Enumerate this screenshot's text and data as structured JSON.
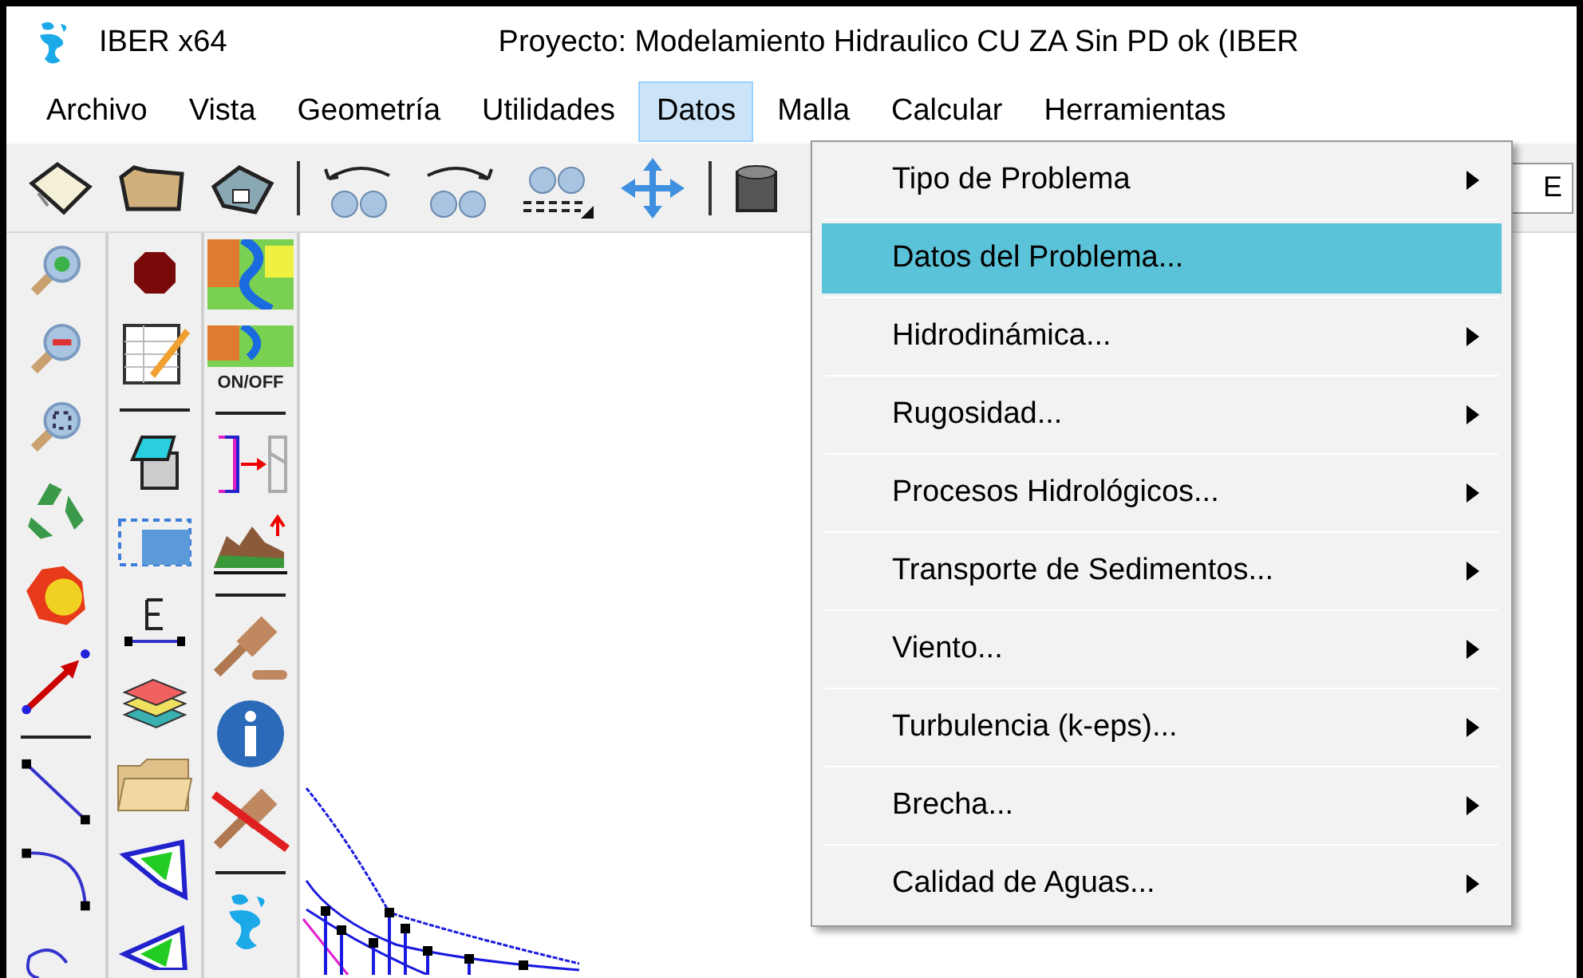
{
  "window": {
    "app_name": "IBER x64",
    "title": "Proyecto: Modelamiento Hidraulico CU ZA Sin PD ok (IBER"
  },
  "menu_bar": [
    {
      "label": "Archivo",
      "selected": false
    },
    {
      "label": "Vista",
      "selected": false
    },
    {
      "label": "Geometría",
      "selected": false
    },
    {
      "label": "Utilidades",
      "selected": false
    },
    {
      "label": "Datos",
      "selected": true
    },
    {
      "label": "Malla",
      "selected": false
    },
    {
      "label": "Calcular",
      "selected": false
    },
    {
      "label": "Herramientas",
      "selected": false
    }
  ],
  "toolbar_field": {
    "value": "E"
  },
  "layer_icon_label": "ON/OFF",
  "dropdown": [
    {
      "label": "Tipo de Problema",
      "submenu": true,
      "selected": false
    },
    {
      "label": "Datos del Problema...",
      "submenu": false,
      "selected": true
    },
    {
      "label": "Hidrodinámica...",
      "submenu": true,
      "selected": false
    },
    {
      "label": "Rugosidad...",
      "submenu": true,
      "selected": false
    },
    {
      "label": "Procesos Hidrológicos...",
      "submenu": true,
      "selected": false
    },
    {
      "label": "Transporte de Sedimentos...",
      "submenu": true,
      "selected": false
    },
    {
      "label": "Viento...",
      "submenu": true,
      "selected": false
    },
    {
      "label": "Turbulencia (k-eps)...",
      "submenu": true,
      "selected": false
    },
    {
      "label": "Brecha...",
      "submenu": true,
      "selected": false
    },
    {
      "label": "Calidad de Aguas...",
      "submenu": true,
      "selected": false
    }
  ]
}
